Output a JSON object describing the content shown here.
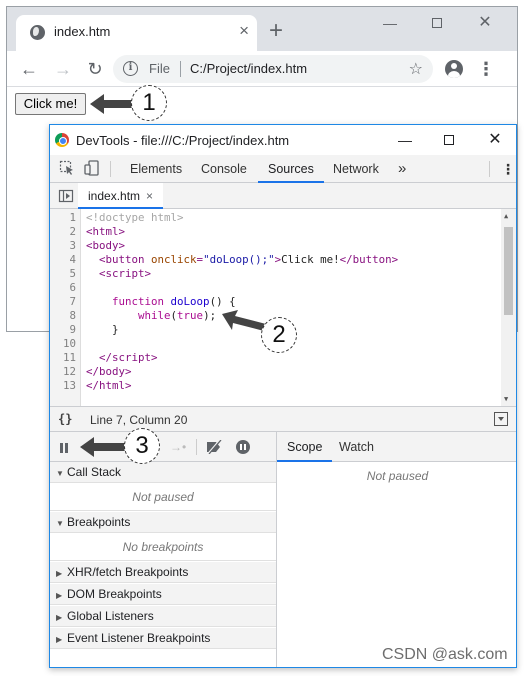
{
  "browser": {
    "tab_title": "index.htm",
    "tab_close": "×",
    "new_tab": "+",
    "min": "—",
    "close": "✕",
    "back": "←",
    "forward": "→",
    "reload": "↻",
    "info": "i",
    "file_label": "File",
    "url": "C:/Project/index.htm",
    "star": "☆",
    "menu": "⋮"
  },
  "page": {
    "button_label": "Click me!"
  },
  "callouts": [
    "1",
    "2",
    "3"
  ],
  "devtools": {
    "title": "DevTools - file:///C:/Project/index.htm",
    "min": "—",
    "close": "✕",
    "tabs": [
      "Elements",
      "Console",
      "Sources",
      "Network"
    ],
    "active_tab": "Sources",
    "more_tabs": "»",
    "menu": "⋮",
    "file_tab": "index.htm",
    "file_tab_close": "×",
    "status": "Line 7, Column 20",
    "status_braces": "{}"
  },
  "code": {
    "line_numbers": [
      "1",
      "2",
      "3",
      "4",
      "5",
      "6",
      "7",
      "8",
      "9",
      "10",
      "11",
      "12",
      "13"
    ]
  },
  "debugger": {
    "sections": {
      "call_stack": "Call Stack",
      "call_stack_empty": "Not paused",
      "breakpoints": "Breakpoints",
      "breakpoints_empty": "No breakpoints",
      "xhr": "XHR/fetch Breakpoints",
      "dom": "DOM Breakpoints",
      "global": "Global Listeners",
      "event": "Event Listener Breakpoints"
    },
    "expanded_marker": "▼",
    "collapsed_marker": "▶",
    "step_icon": "→•"
  },
  "scope": {
    "tabs": [
      "Scope",
      "Watch"
    ],
    "active_tab": "Scope",
    "empty": "Not paused"
  },
  "watermark": "CSDN @ask.com"
}
